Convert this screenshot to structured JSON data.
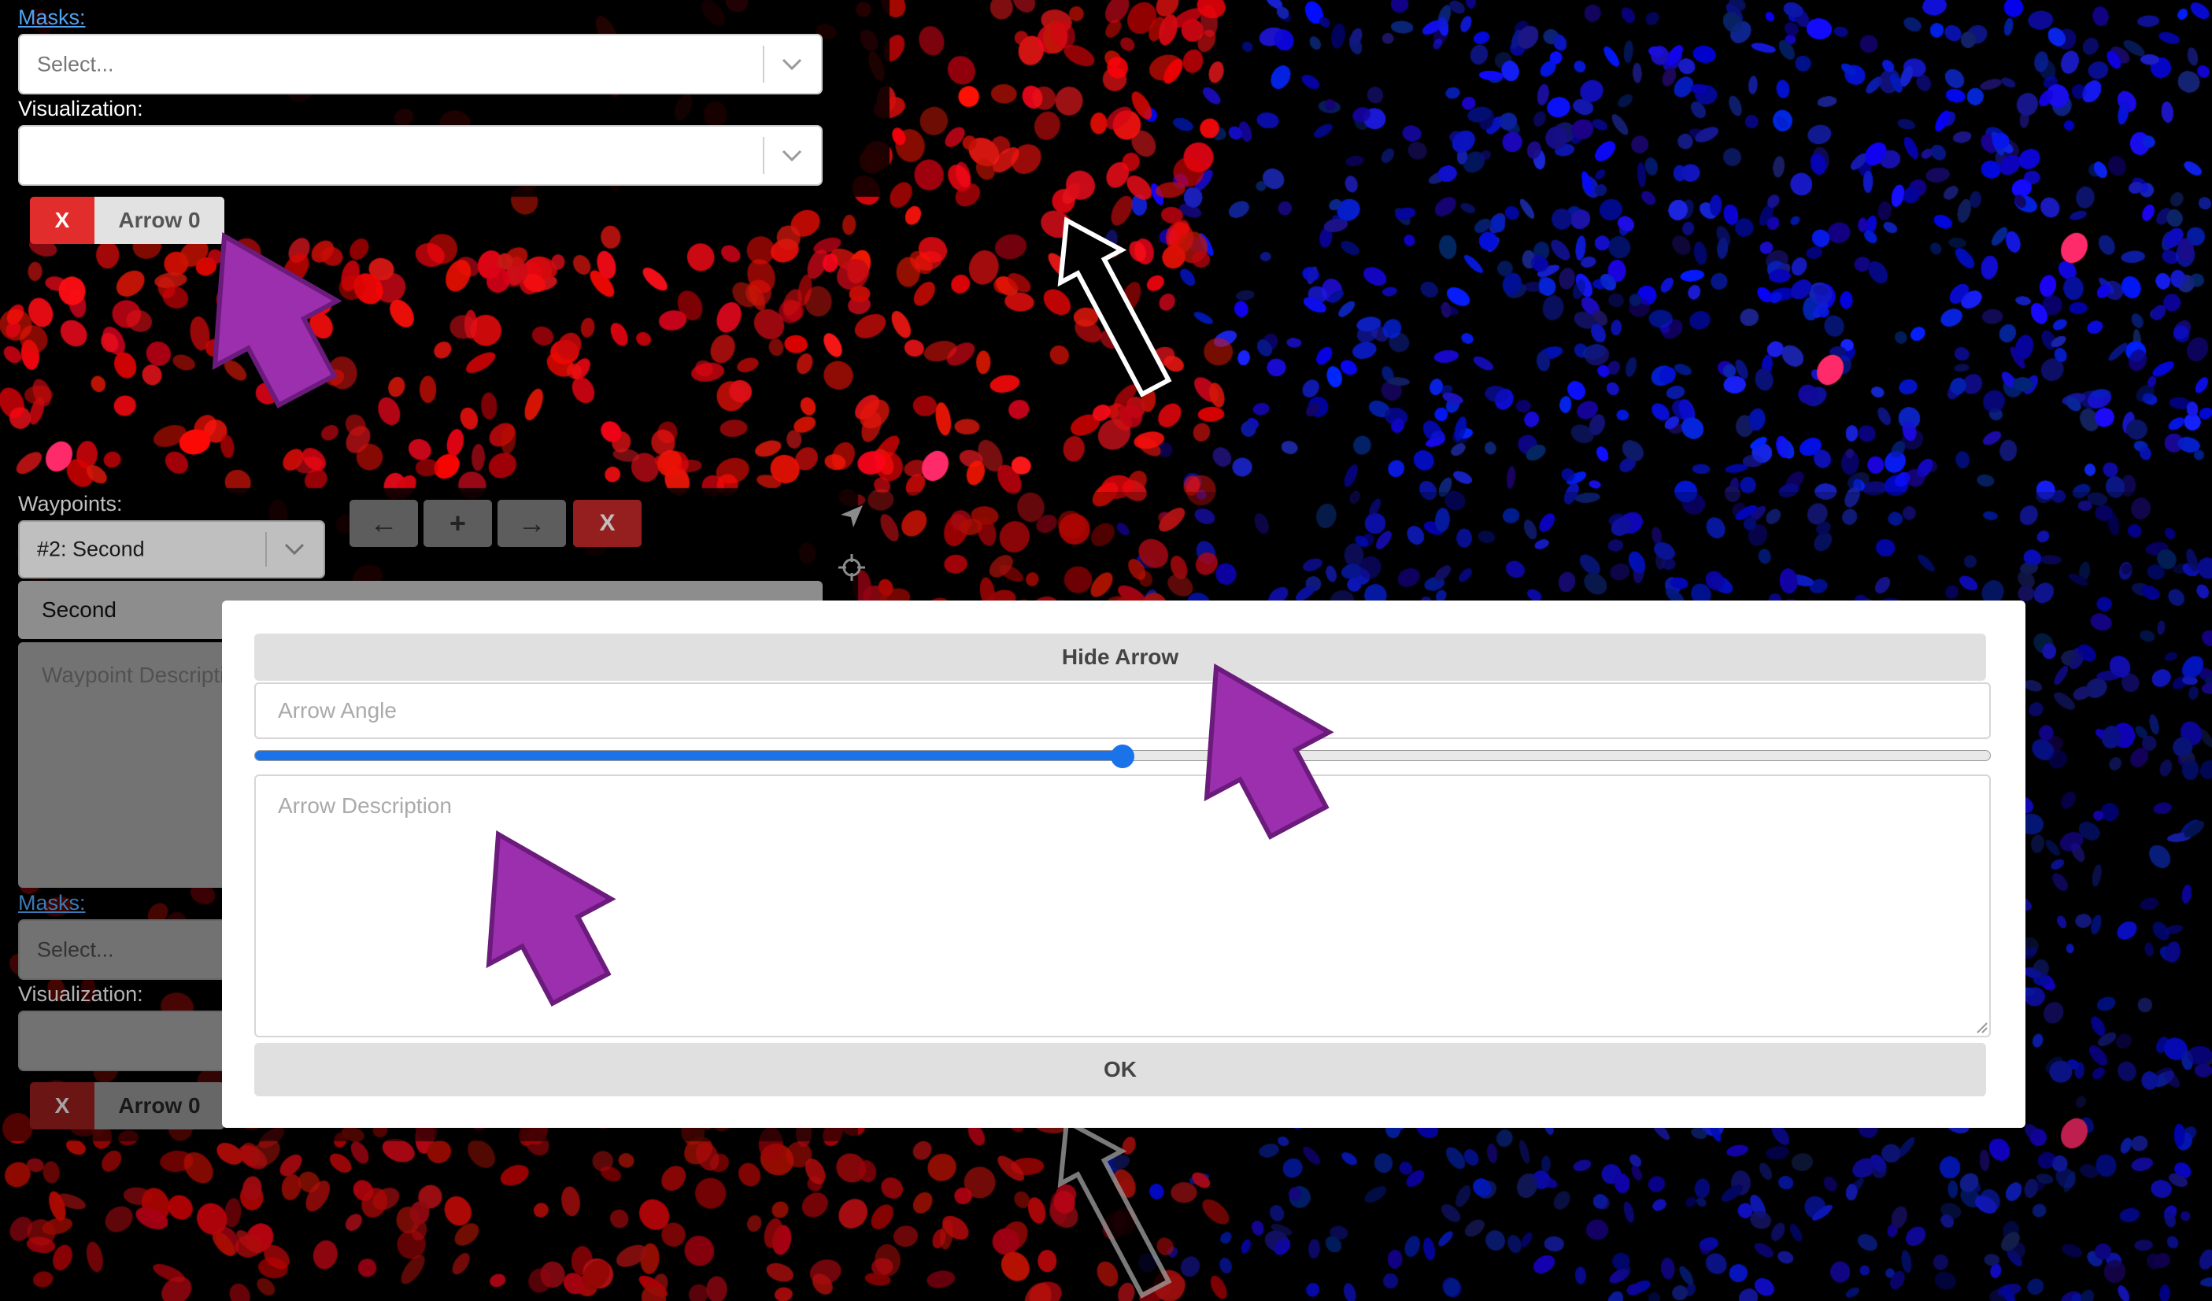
{
  "top_panel": {
    "masks_label": "Masks:",
    "masks_placeholder": "Select...",
    "visualization_label": "Visualization:",
    "visualization_value": "",
    "delete_label": "X",
    "arrow_label": "Arrow 0"
  },
  "waypoints": {
    "label": "Waypoints:",
    "selected": "#2: Second",
    "buttons": {
      "prev": "←",
      "add": "+",
      "next": "→",
      "delete": "X"
    },
    "title_value": "Second",
    "description_placeholder": "Waypoint Description"
  },
  "bottom_panel": {
    "masks_label": "Masks:",
    "masks_placeholder": "Select...",
    "visualization_label": "Visualization:",
    "delete_label": "X",
    "arrow_label": "Arrow 0"
  },
  "tools": {
    "arrow_tool_icon": "location-arrow-icon",
    "crosshair_icon": "crosshair-icon"
  },
  "dialog": {
    "hide_arrow_label": "Hide Arrow",
    "angle_placeholder": "Arrow Angle",
    "angle_slider_fraction": 0.5,
    "description_placeholder": "Arrow Description",
    "ok_label": "OK"
  },
  "colors": {
    "accent_blue": "#1a73e8",
    "delete_red": "#e22d2d",
    "link_blue": "#4ea3f1",
    "annotation_purple": "#9b2fae"
  }
}
